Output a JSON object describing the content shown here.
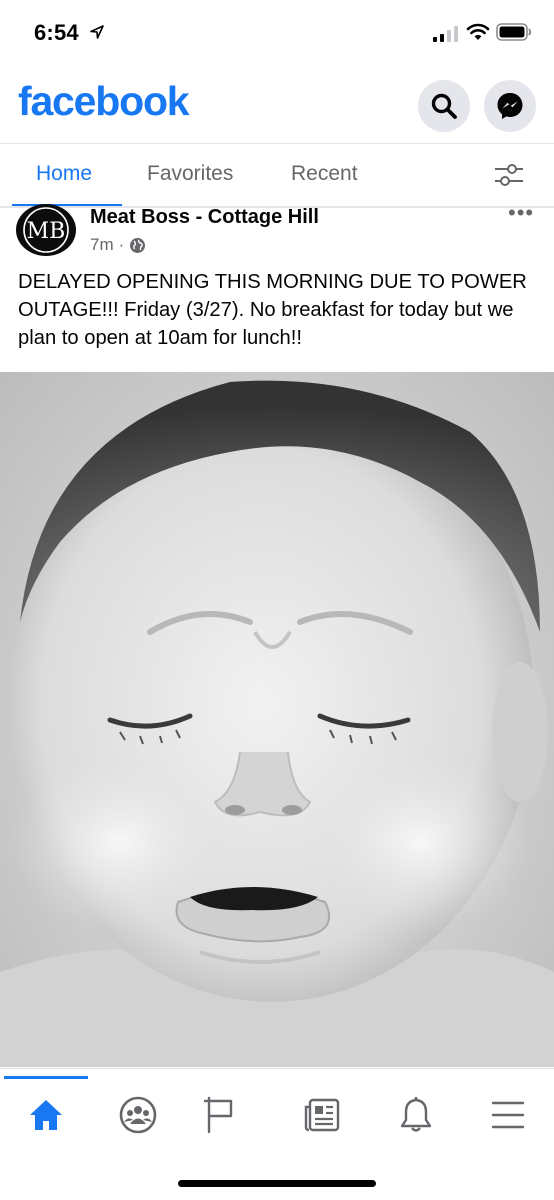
{
  "status_bar": {
    "time": "6:54",
    "icons": [
      "location-arrow-icon",
      "cellular-signal-icon",
      "wifi-icon",
      "battery-icon"
    ]
  },
  "header": {
    "brand": "facebook",
    "brand_color": "#1877f2",
    "buttons": [
      "search-icon",
      "messenger-icon"
    ]
  },
  "tabs": {
    "items": [
      "Home",
      "Favorites",
      "Recent"
    ],
    "active": "Home",
    "filter_icon": "filter-sliders-icon"
  },
  "post": {
    "author": "Meat Boss - Cottage Hill",
    "avatar_text": "MB",
    "time": "7m",
    "separator": "·",
    "privacy_icon": "globe-icon",
    "more_label": "•••",
    "text": "DELAYED OPENING THIS MORNING DUE TO POWER OUTAGE!!!  Friday (3/27). No breakfast for today but we plan to open at 10am for lunch!!",
    "image": "crying-baby-photo"
  },
  "bottom_nav": {
    "items": [
      "home-icon",
      "groups-icon",
      "pages-flag-icon",
      "news-icon",
      "notifications-bell-icon",
      "menu-icon"
    ],
    "active": "home-icon"
  }
}
